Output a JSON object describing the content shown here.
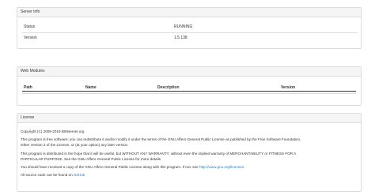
{
  "server_info": {
    "heading": "Server Info",
    "rows": [
      {
        "label": "Status",
        "value": "RUNNING"
      },
      {
        "label": "Version",
        "value": "1.5.138"
      }
    ]
  },
  "web_modules": {
    "heading": "Web Modules",
    "columns": [
      "Path",
      "Name",
      "Description",
      "Version"
    ]
  },
  "license": {
    "heading": "License",
    "copyright": "Copyright (C) 2009-2019 BIMserver.org",
    "para1_line1": "This program is free software: you can redistribute it and/or modify it under the terms of the GNU Affero General Public License as published by the Free Software Foundation,",
    "para1_line2": "either version 3 of the License, or (at your option) any later version.",
    "para2_line1": "This program is distributed in the hope that it will be useful, but WITHOUT ANY WARRANTY; without even the implied warranty of MERCHANTABILITY or FITNESS FOR A",
    "para2_line2": "PARTICULAR PURPOSE. See the GNU Affero General Public License for more details.",
    "para3_text": "You should have received a copy of the GNU Affero General Public License along with this program. If not, see",
    "para3_link": "http://www.gnu.org/licenses",
    "source_text": "All source code can be found on",
    "source_link": "GitHub"
  }
}
